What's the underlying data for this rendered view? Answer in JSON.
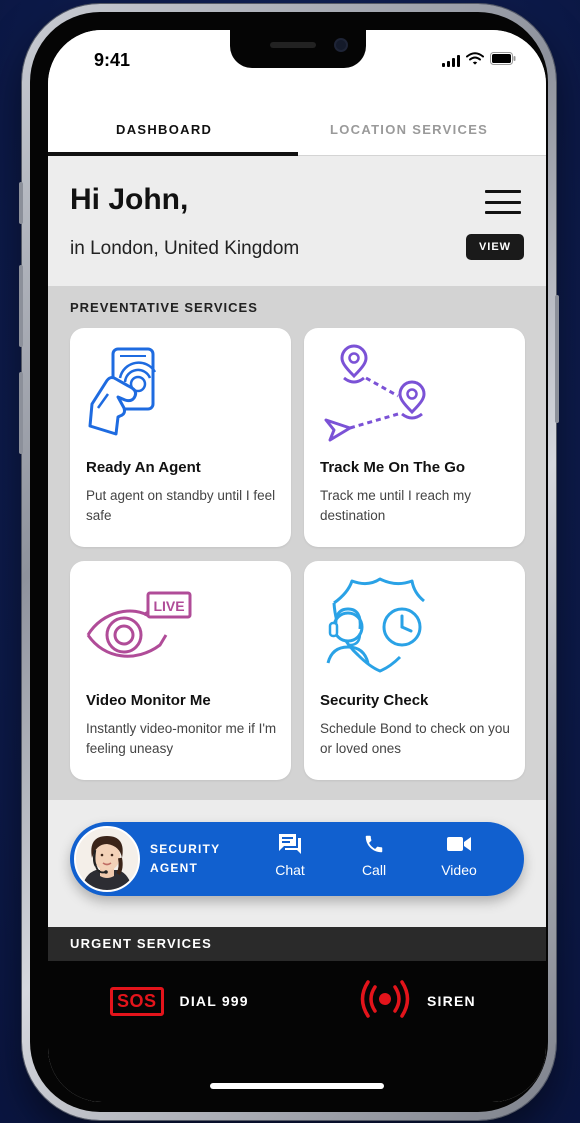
{
  "status_bar": {
    "time": "9:41"
  },
  "tabs": [
    {
      "label": "DASHBOARD",
      "active": true
    },
    {
      "label": "LOCATION SERVICES",
      "active": false
    }
  ],
  "greeting": {
    "title": "Hi John,",
    "location": "in London, United Kingdom",
    "view_label": "VIEW"
  },
  "preventative": {
    "section_title": "PREVENTATIVE SERVICES",
    "cards": [
      {
        "title": "Ready An Agent",
        "description": "Put agent on standby until I feel safe",
        "icon": "hand-tap-phone-icon"
      },
      {
        "title": "Track Me On The Go",
        "description": "Track me until I reach my destination",
        "icon": "route-tracking-icon"
      },
      {
        "title": "Video Monitor Me",
        "description": "Instantly video-monitor me if I'm feeling uneasy",
        "icon": "live-eye-icon",
        "badge": "LIVE"
      },
      {
        "title": "Security Check",
        "description": "Schedule Bond to check on you or loved ones",
        "icon": "shield-agent-clock-icon"
      }
    ]
  },
  "agent_bar": {
    "label": "SECURITY AGENT",
    "actions": [
      {
        "label": "Chat",
        "icon": "chat-icon"
      },
      {
        "label": "Call",
        "icon": "phone-icon"
      },
      {
        "label": "Video",
        "icon": "video-camera-icon"
      }
    ]
  },
  "urgent": {
    "section_title": "URGENT SERVICES",
    "buttons": [
      {
        "badge": "SOS",
        "label": "DIAL 999",
        "icon": "sos-icon"
      },
      {
        "label": "SIREN",
        "icon": "siren-icon"
      }
    ]
  },
  "colors": {
    "accent_blue": "#1160cf",
    "alert_red": "#e3141b",
    "icon_blue": "#1e6be0",
    "icon_purple": "#7b52d6",
    "icon_magenta": "#b04c98",
    "icon_cyan": "#2aa2e6"
  }
}
